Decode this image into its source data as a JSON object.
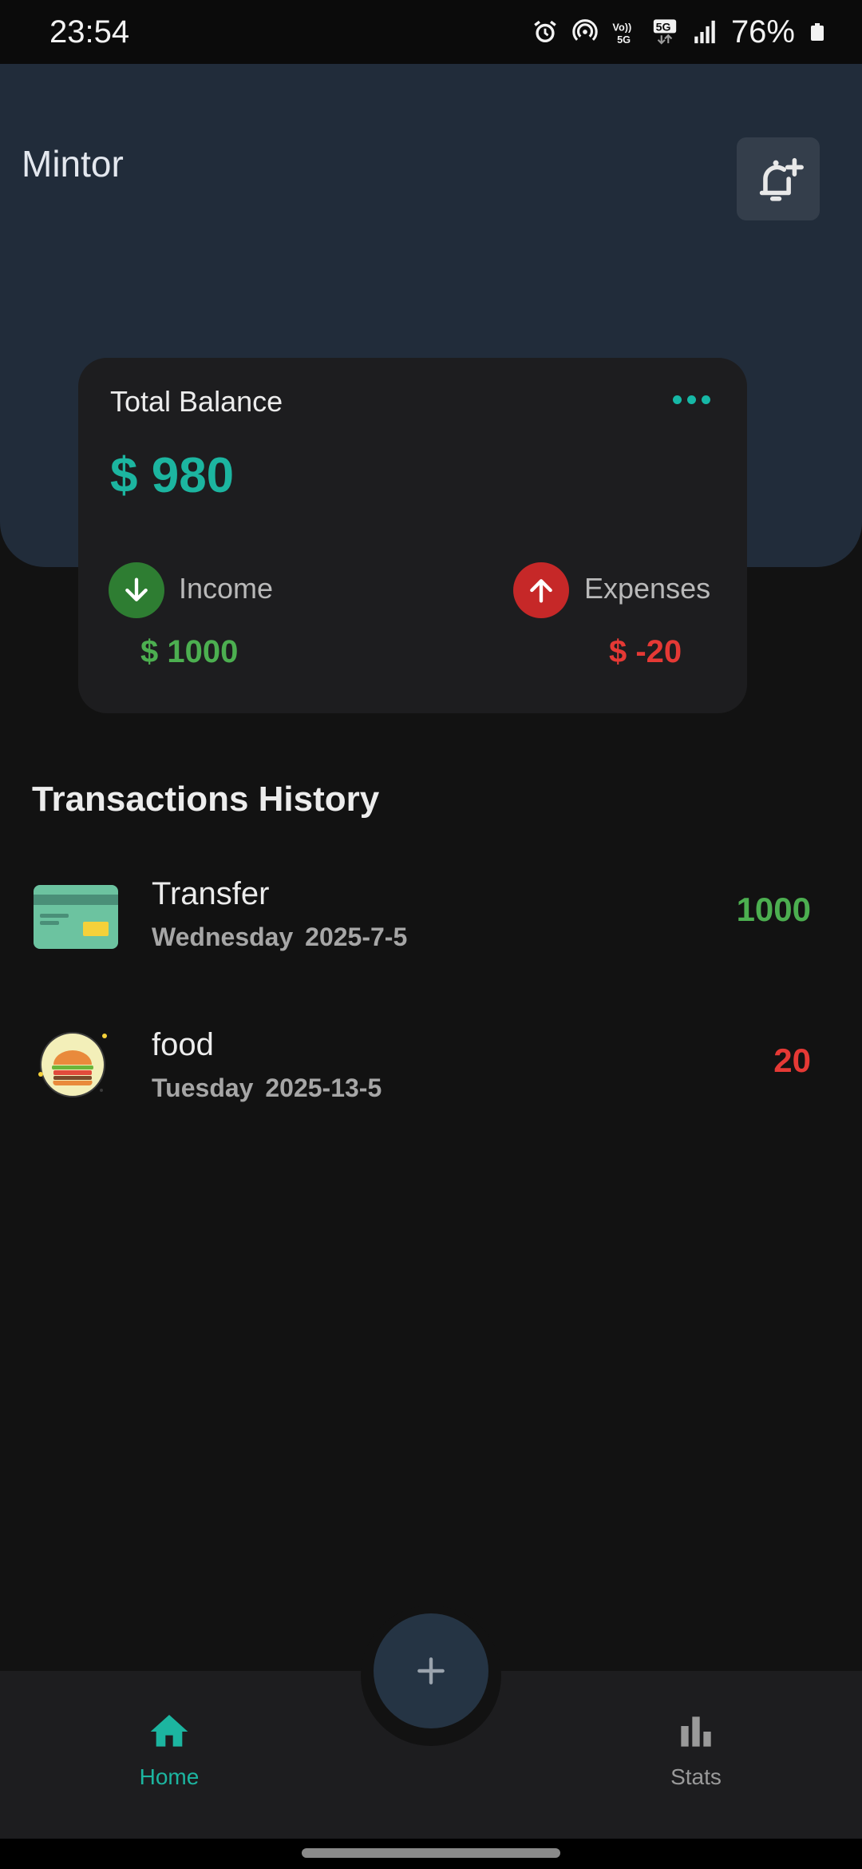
{
  "status_bar": {
    "time": "23:54",
    "battery": "76%",
    "icons": [
      "alarm-icon",
      "hotspot-icon",
      "volte-icon",
      "5g-icon",
      "signal-icon",
      "battery-icon"
    ]
  },
  "header": {
    "title": "Mintor",
    "bell_button_icon": "bell-plus-icon"
  },
  "balance_card": {
    "title": "Total Balance",
    "balance": "$ 980",
    "income_label": "Income",
    "income_amount": "$ 1000",
    "expenses_label": "Expenses",
    "expenses_amount": "$ -20"
  },
  "transactions": {
    "title": "Transactions History",
    "items": [
      {
        "name": "Transfer",
        "date": "Wednesday  2025-7-5",
        "amount": "1000",
        "icon": "credit-card-icon"
      },
      {
        "name": "food",
        "date": "Tuesday  2025-13-5",
        "amount": "20",
        "icon": "burger-icon"
      }
    ]
  },
  "bottom_nav": {
    "home_label": "Home",
    "stats_label": "Stats",
    "fab_icon": "plus-icon"
  },
  "colors": {
    "accent": "#1cb5a0",
    "income": "#4caf50",
    "expense": "#e53935",
    "header_bg": "#212c3a",
    "card_bg": "#1d1d1f"
  }
}
